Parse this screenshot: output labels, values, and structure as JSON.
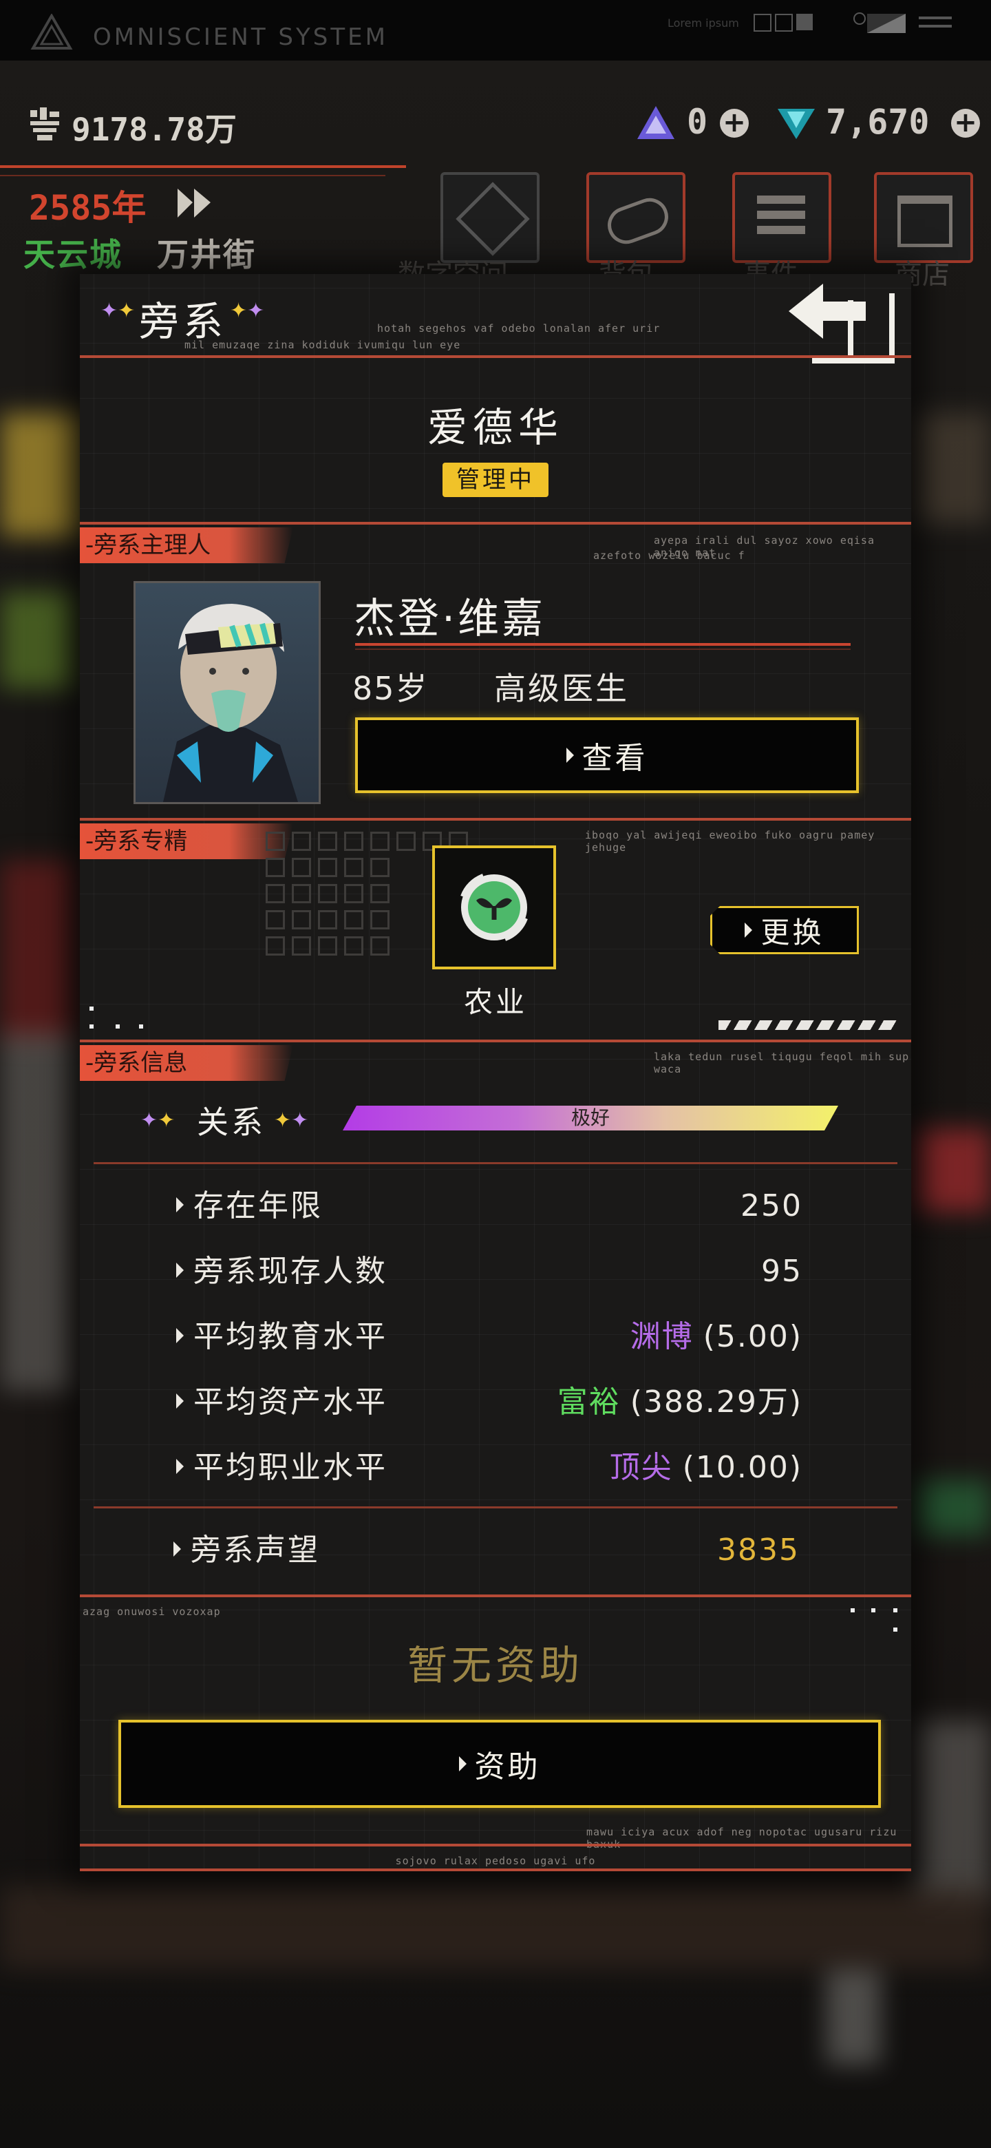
{
  "app": {
    "system_name": "OMNISCIENT SYSTEM",
    "lorem": "Lorem ipsum"
  },
  "hud": {
    "money": "9178.78万",
    "year": "2585年",
    "location_city": "天云城",
    "location_street": "万井街",
    "gem_a": "0",
    "gem_b": "7,670",
    "nav": [
      "数字空间",
      "背包",
      "事件",
      "商店"
    ]
  },
  "panel": {
    "title": "旁系",
    "title_micro_1": "hotah segehos vaf odebo lonalan afer urir",
    "title_micro_2": "mil emuzaqe zina kodiduk ivumiqu lun eye",
    "family_name": "爱德华",
    "status_badge": "管理中",
    "leader": {
      "tag": "-旁系主理人",
      "micro_1": "ayepa irali dul sayoz xowo eqisa anigo nat",
      "micro_2": "azefoto wozelu bacuc f",
      "name": "杰登·维嘉",
      "age": "85岁",
      "job": "高级医生",
      "view_button": "查看"
    },
    "specialty": {
      "tag": "-旁系专精",
      "micro": "iboqo yal awijeqi eweoibo fuko oagru pamey jehuge",
      "name": "农业",
      "change_button": "更换",
      "icon": "sprout-icon"
    },
    "info": {
      "tag": "-旁系信息",
      "micro": "laka tedun rusel tiqugu feqol mih sup waca",
      "relation_label": "关系",
      "relation_value": "极好",
      "rows": [
        {
          "label": "存在年限",
          "value": "250",
          "tier": "",
          "tier_color": ""
        },
        {
          "label": "旁系现存人数",
          "value": "95",
          "tier": "",
          "tier_color": ""
        },
        {
          "label": "平均教育水平",
          "value": "(5.00)",
          "tier": "渊博",
          "tier_color": "#b56ce8"
        },
        {
          "label": "平均资产水平",
          "value": "(388.29万)",
          "tier": "富裕",
          "tier_color": "#5fdc5f"
        },
        {
          "label": "平均职业水平",
          "value": "(10.00)",
          "tier": "顶尖",
          "tier_color": "#b56ce8"
        }
      ],
      "reputation_label": "旁系声望",
      "reputation_value": "3835"
    },
    "sponsor": {
      "micro_1": "azag onuwosi vozoxap",
      "status": "暂无资助",
      "button": "资助",
      "micro_2": "mawu iciya acux adof neg nopotac ugusaru rizu baxuk",
      "micro_3": "sojovo rulax pedoso ugavi ufo"
    }
  },
  "colors": {
    "accent_orange": "#e5533a",
    "accent_yellow": "#e6c22c",
    "gold_text": "#d9b43a"
  }
}
